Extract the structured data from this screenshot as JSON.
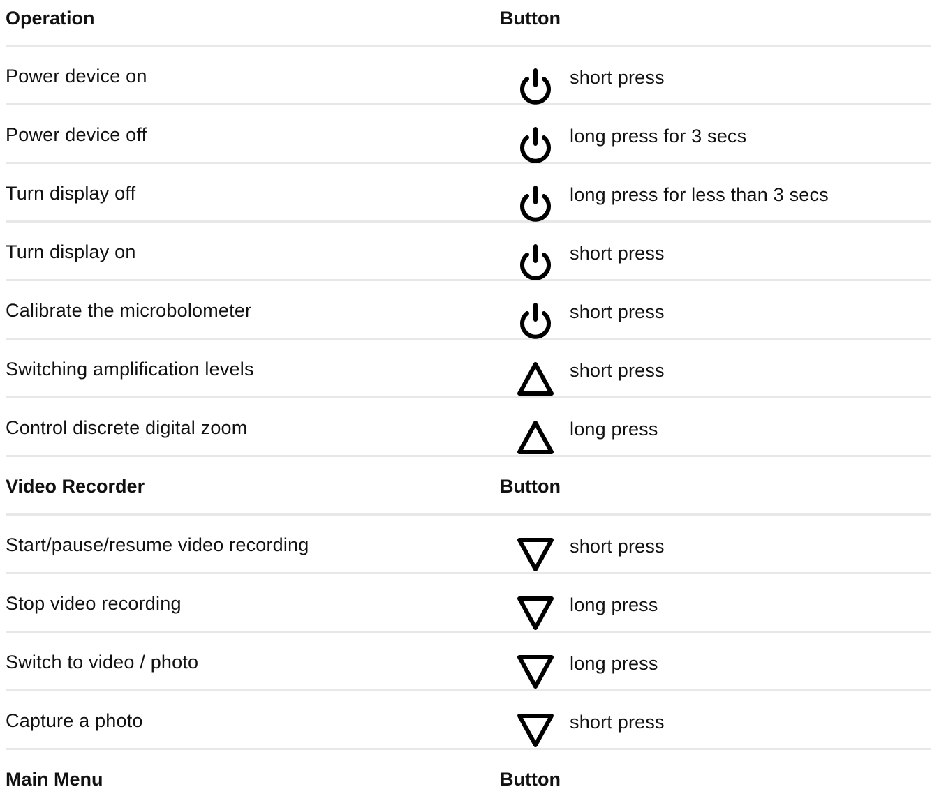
{
  "sections": [
    {
      "header": {
        "operation": "Operation",
        "button": "Button"
      },
      "rows": [
        {
          "operation": "Power device on",
          "icon": "power-icon",
          "action": "short press"
        },
        {
          "operation": "Power device off",
          "icon": "power-icon",
          "action": "long press for 3 secs"
        },
        {
          "operation": "Turn display off",
          "icon": "power-icon",
          "action": "long press for less than 3 secs"
        },
        {
          "operation": "Turn display on",
          "icon": "power-icon",
          "action": "short press"
        },
        {
          "operation": "Calibrate the microbolometer",
          "icon": "power-icon",
          "action": "short press"
        },
        {
          "operation": "Switching amplification levels",
          "icon": "triangle-up-icon",
          "action": "short press"
        },
        {
          "operation": "Control discrete digital zoom",
          "icon": "triangle-up-icon",
          "action": "long press"
        }
      ]
    },
    {
      "header": {
        "operation": "Video Recorder",
        "button": "Button"
      },
      "rows": [
        {
          "operation": "Start/pause/resume video recording",
          "icon": "triangle-down-icon",
          "action": "short press"
        },
        {
          "operation": "Stop video recording",
          "icon": "triangle-down-icon",
          "action": "long press"
        },
        {
          "operation": "Switch to video / photo",
          "icon": "triangle-down-icon",
          "action": "long press"
        },
        {
          "operation": "Capture a photo",
          "icon": "triangle-down-icon",
          "action": "short press"
        }
      ]
    },
    {
      "header": {
        "operation": "Main Menu",
        "button": "Button"
      },
      "rows": []
    }
  ]
}
